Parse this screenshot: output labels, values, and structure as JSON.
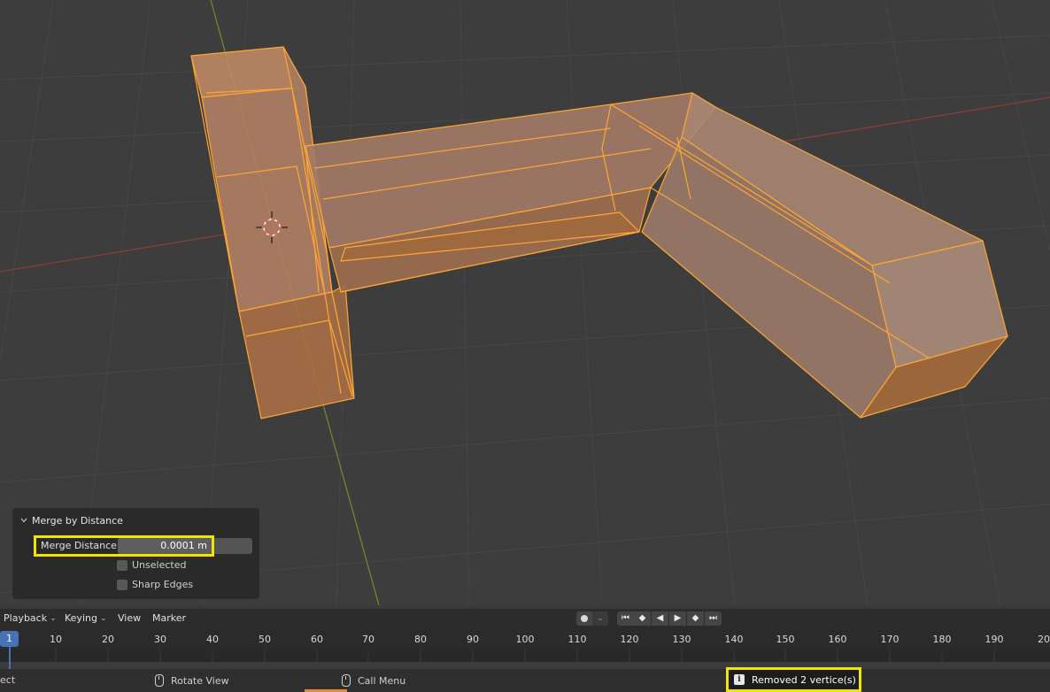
{
  "operator_panel": {
    "title": "Merge by Distance",
    "merge_distance_label": "Merge Distance",
    "merge_distance_value": "0.0001 m",
    "unselected_label": "Unselected",
    "unselected_checked": false,
    "sharp_edges_label": "Sharp Edges",
    "sharp_edges_checked": false
  },
  "timeline": {
    "menus": [
      "Playback",
      "Keying",
      "View",
      "Marker"
    ],
    "current_frame": "1",
    "ruler_labels": [
      "10",
      "20",
      "30",
      "40",
      "50",
      "60",
      "70",
      "80",
      "90",
      "100",
      "110",
      "120",
      "130",
      "140",
      "150",
      "160",
      "170",
      "180",
      "190",
      "20"
    ]
  },
  "statusbar": {
    "left_text": "ect",
    "rotate_view": "Rotate View",
    "call_menu": "Call Menu",
    "report": "Removed 2 vertice(s)"
  },
  "colors": {
    "mesh_face": "#c9865a",
    "mesh_edge": "#ffa633",
    "x_axis": "#8a3d3d",
    "y_axis": "#6a8a2a",
    "highlight": "#f2e600",
    "frame_accent": "#4772b3"
  }
}
